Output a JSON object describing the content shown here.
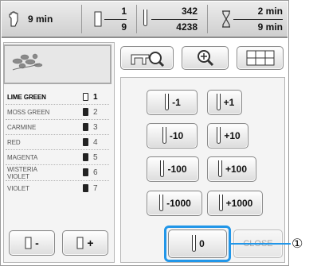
{
  "status_bar": {
    "time_remaining": "9 min",
    "color_current": "1",
    "color_total": "9",
    "stitch_current": "342",
    "stitch_total": "4238",
    "time_current": "2 min",
    "time_total": "9 min"
  },
  "color_list": [
    {
      "name": "LIME GREEN",
      "number": "1",
      "active": true
    },
    {
      "name": "MOSS GREEN",
      "number": "2"
    },
    {
      "name": "CARMINE",
      "number": "3"
    },
    {
      "name": "RED",
      "number": "4"
    },
    {
      "name": "MAGENTA",
      "number": "5"
    },
    {
      "name": "WISTERIA VIOLET",
      "number": "6"
    },
    {
      "name": "VIOLET",
      "number": "7"
    }
  ],
  "buttons": {
    "minus_1": "-1",
    "plus_1": "+1",
    "minus_10": "-10",
    "plus_10": "+10",
    "minus_100": "-100",
    "plus_100": "+100",
    "minus_1000": "-1000",
    "plus_1000": "+1000",
    "zero": "0",
    "close": "CLOSE",
    "color_minus": "-",
    "color_plus": "+"
  },
  "callout": "①",
  "colors": {
    "accent": "#2196e8"
  }
}
